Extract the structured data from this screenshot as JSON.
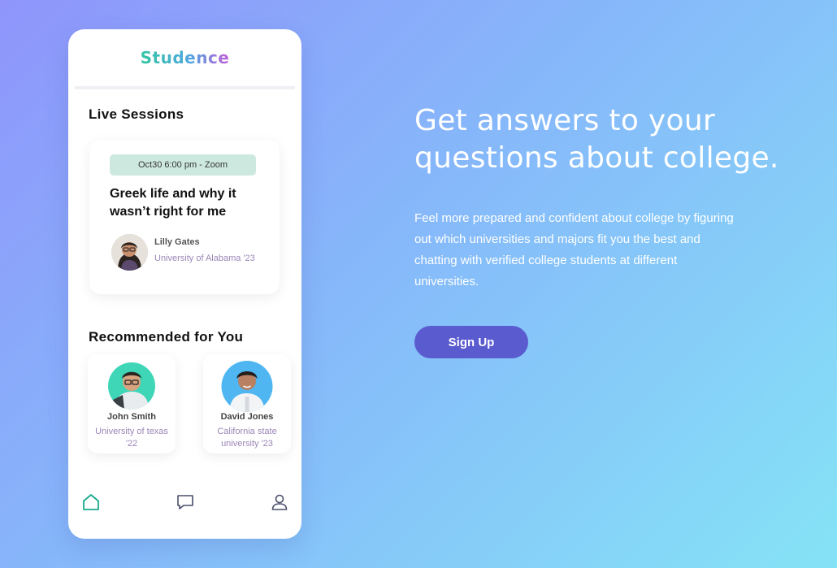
{
  "app": {
    "logo_text": "Studence"
  },
  "live_sessions": {
    "title": "Live Sessions",
    "card": {
      "badge": "Oct30 6:00 pm  - Zoom",
      "title": "Greek life and why it wasn’t right for me",
      "host_name": "Lilly Gates",
      "host_school": "University of Alabama '23"
    }
  },
  "recommended": {
    "title": "Recommended for You",
    "people": [
      {
        "name": "John Smith",
        "school": "University of texas '22"
      },
      {
        "name": "David Jones",
        "school": "California state university '23"
      }
    ]
  },
  "tabbar": {
    "items": [
      {
        "icon": "home-icon",
        "active": true
      },
      {
        "icon": "chat-icon",
        "active": false
      },
      {
        "icon": "profile-icon",
        "active": false
      }
    ]
  },
  "hero": {
    "title": "Get answers to your questions about college.",
    "description": "Feel more prepared and confident about college by figuring out which universities and majors fit you the best and chatting with verified college students at different universities.",
    "cta_label": "Sign Up"
  },
  "colors": {
    "accent": "#5b5bd0",
    "badge_bg": "#cde9df",
    "home_active": "#19a98c",
    "muted_text": "#9a86b6"
  }
}
